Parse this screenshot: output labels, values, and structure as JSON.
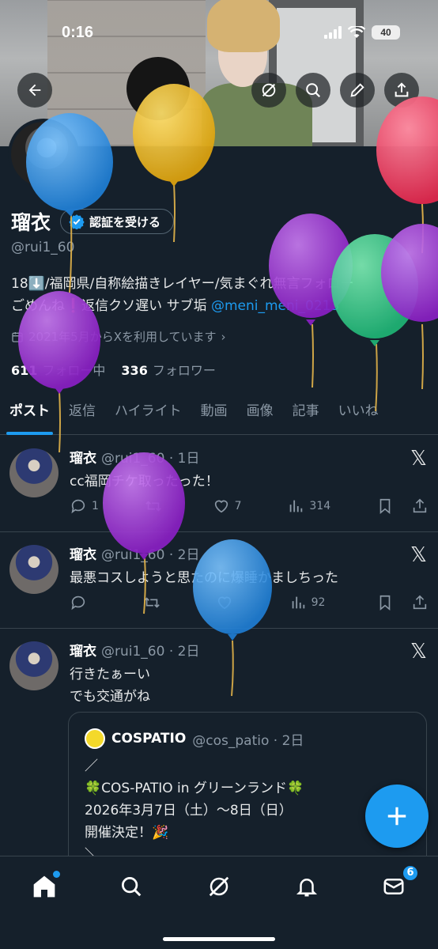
{
  "status_bar": {
    "time": "0:16",
    "battery": "40"
  },
  "profile": {
    "name": "瑠衣",
    "verify_label": "認証を受ける",
    "handle": "@rui1_60",
    "bio_line1": "18⬇️/福岡県/自称絵描きレイヤー/気まぐれ無言フォロー",
    "bio_line2_prefix": "ごめんね❗️返信クソ遅い サブ垢",
    "bio_mention": "@meni_meni_0213",
    "joined": "2021年5月からXを利用しています",
    "following_count": "611",
    "following_label": "フォロー中",
    "followers_count": "336",
    "followers_label": "フォロワー"
  },
  "tabs": [
    "ポスト",
    "返信",
    "ハイライト",
    "動画",
    "画像",
    "記事",
    "いいね"
  ],
  "posts": [
    {
      "name": "瑠衣",
      "meta": "@rui1_60 · 1日",
      "text": "cc福岡チケ取ったった！",
      "replies": "1",
      "reposts": "",
      "likes": "7",
      "views": "314"
    },
    {
      "name": "瑠衣",
      "meta": "@rui1_60 · 2日",
      "text": "最悪コスしようと思たのに爆睡かましちった",
      "replies": "",
      "reposts": "",
      "likes": "",
      "views": "92"
    },
    {
      "name": "瑠衣",
      "meta": "@rui1_60 · 2日",
      "text_line1": "行きたぁーい",
      "text_line2": "でも交通がね",
      "quote": {
        "name": "COSPATIO",
        "meta": "@cos_patio · 2日",
        "text": "／\n🍀COS-PATIO in グリーンランド🍀\n2026年3月7日（土）〜8日（日）\n開催決定！🎉\n＼"
      }
    }
  ],
  "nav": {
    "messages_badge": "6"
  },
  "colors": {
    "accent": "#1d9bf0",
    "background": "#15202b",
    "border": "#38444d",
    "muted": "#8b98a5"
  },
  "icons": [
    "back-arrow-icon",
    "grok-icon",
    "search-icon",
    "pencil-icon",
    "share-icon",
    "verified-badge-icon",
    "calendar-icon",
    "reply-icon",
    "repost-icon",
    "like-icon",
    "views-icon",
    "bookmark-icon",
    "x-logo-icon",
    "plus-icon",
    "home-icon",
    "explore-icon",
    "notifications-icon",
    "messages-icon"
  ]
}
